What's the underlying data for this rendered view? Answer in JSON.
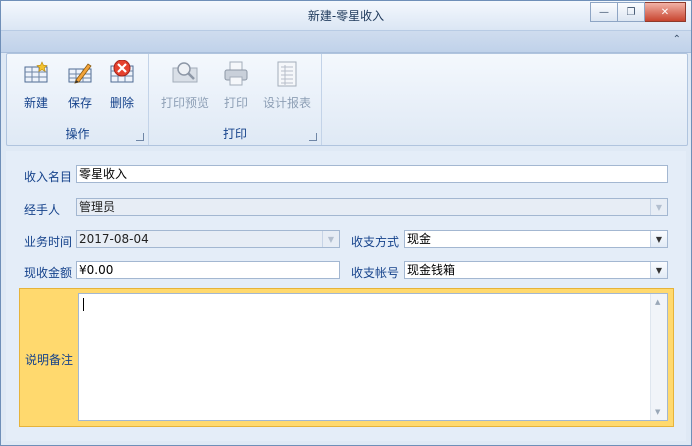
{
  "window": {
    "title": "新建-零星收入",
    "minimize_glyph": "—",
    "restore_glyph": "❐",
    "close_glyph": "✕",
    "collapse_glyph": "⌃"
  },
  "ribbon": {
    "groups": [
      {
        "label": "操作",
        "buttons": [
          {
            "label": "新建",
            "icon": "new-grid-icon",
            "enabled": true
          },
          {
            "label": "保存",
            "icon": "save-grid-pencil-icon",
            "enabled": true
          },
          {
            "label": "删除",
            "icon": "delete-x-icon",
            "enabled": true
          }
        ]
      },
      {
        "label": "打印",
        "buttons": [
          {
            "label": "打印预览",
            "icon": "magnifier-icon",
            "enabled": false
          },
          {
            "label": "打印",
            "icon": "printer-icon",
            "enabled": false
          },
          {
            "label": "设计报表",
            "icon": "report-design-icon",
            "enabled": false
          }
        ]
      }
    ]
  },
  "form": {
    "income_name": {
      "label": "收入名目",
      "value": "零星收入"
    },
    "handler": {
      "label": "经手人",
      "value": "管理员"
    },
    "business_time": {
      "label": "业务时间",
      "value": "2017-08-04"
    },
    "payment_method": {
      "label": "收支方式",
      "value": "现金"
    },
    "cash_amount": {
      "label": "现收金额",
      "value": "¥0.00"
    },
    "account": {
      "label": "收支帐号",
      "value": "现金钱箱"
    },
    "remarks": {
      "label": "说明备注",
      "value": ""
    }
  },
  "colors": {
    "window_bg": "#dfe9f5",
    "label_text": "#15428b",
    "memo_highlight": "#ffd96e",
    "close_button": "#c8452f"
  }
}
